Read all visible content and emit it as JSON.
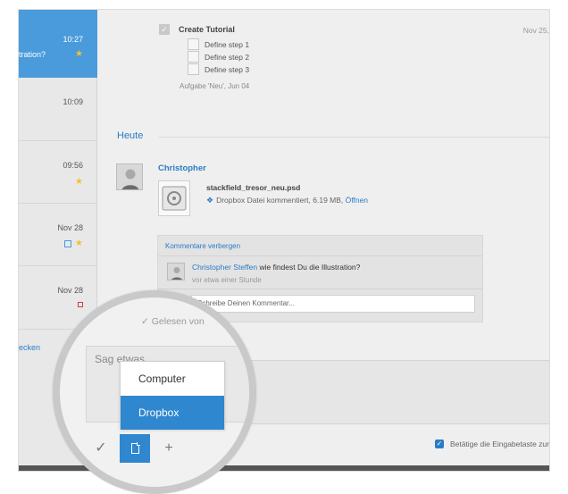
{
  "sidebar": {
    "items": [
      {
        "time": "10:27",
        "text": "tration?",
        "star": true,
        "active": true
      },
      {
        "time": "10:09"
      },
      {
        "time": "09:56",
        "star": true
      },
      {
        "time": "Nov 28",
        "star": true,
        "blue_square": true
      },
      {
        "time": "Nov 28",
        "red_square": true
      }
    ],
    "link": "ecken"
  },
  "task": {
    "title": "Create Tutorial",
    "steps": [
      "Define step 1",
      "Define step 2",
      "Define step 3"
    ],
    "meta": "Aufgabe 'Neu', Jun 04",
    "date": "Nov 25,"
  },
  "feed": {
    "section": "Heute",
    "author": "Christopher",
    "file_name": "stackfield_tresor_neu.psd",
    "file_meta": "Dropbox Datei kommentiert, 6.19 MB,",
    "open_link": "Öffnen"
  },
  "comments": {
    "hide_link": "Kommentare verbergen",
    "items": [
      {
        "who": "Christopher Steffen",
        "text": "wie findest Du die Illustration?",
        "time": "vor etwa einer Stunde"
      }
    ],
    "placeholder": "Schreibe Deinen Kommentar..."
  },
  "composer": {
    "read_by": "Gelesen von",
    "placeholder": "Sag etwas",
    "menu": [
      "Computer",
      "Dropbox"
    ],
    "selected": "Dropbox",
    "enter_hint": "Betätige die Eingabetaste zur"
  },
  "colors": {
    "accent": "#2f87cf",
    "sidebar_active": "#4a9bdb",
    "star": "#f2c230",
    "red": "#d23b3b"
  }
}
